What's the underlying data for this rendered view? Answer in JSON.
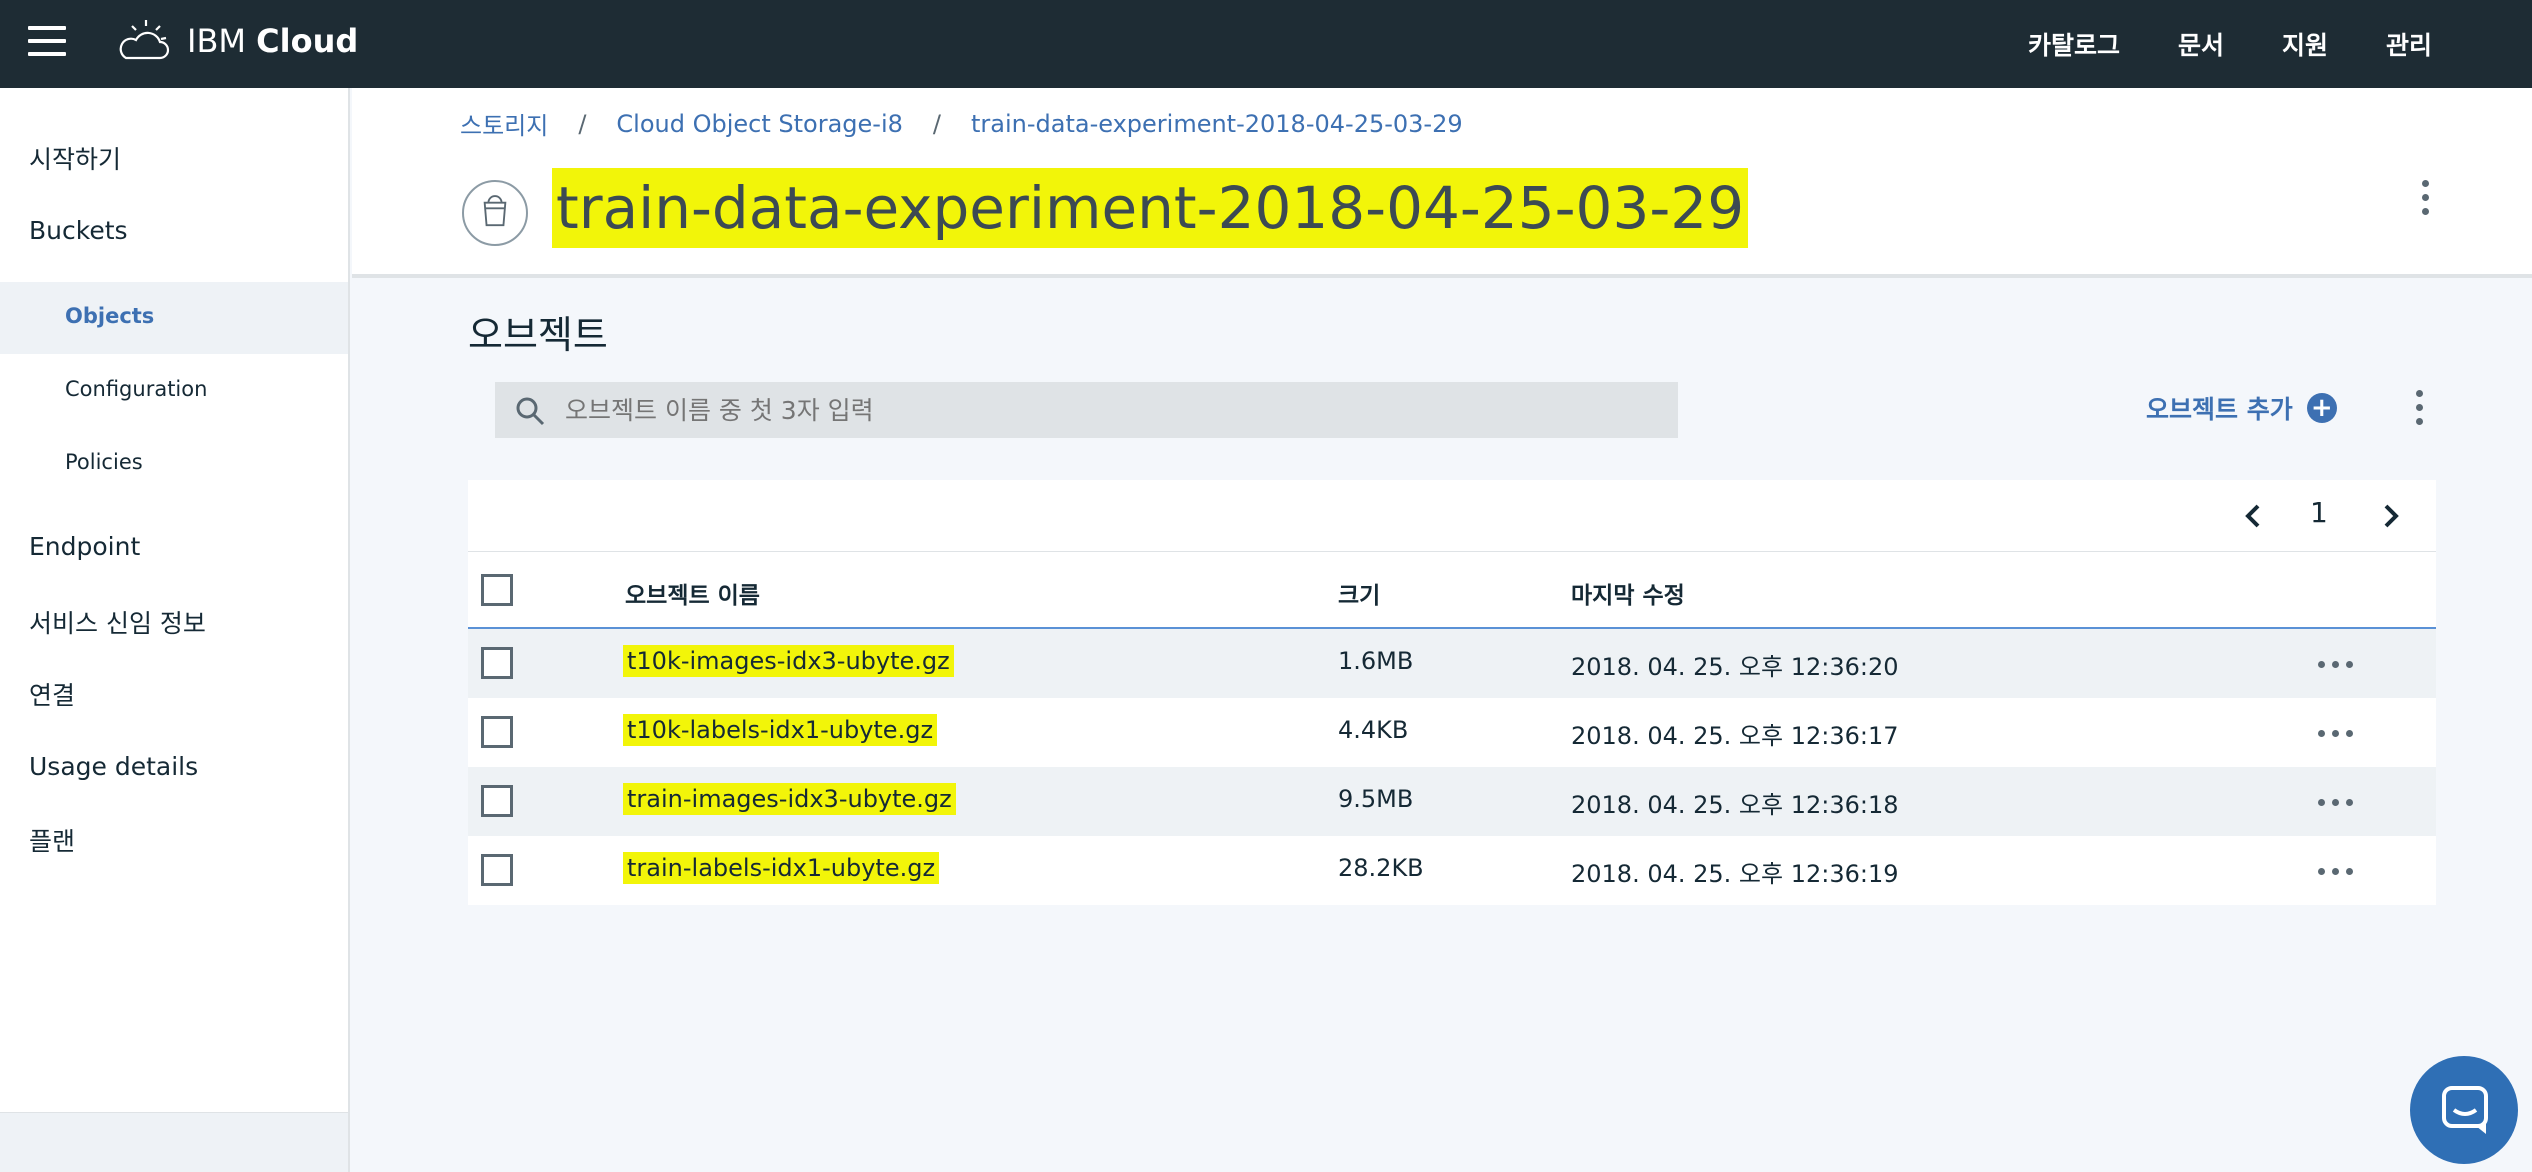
{
  "topbar": {
    "brand_prefix": "IBM",
    "brand_name": "Cloud",
    "nav": [
      "카탈로그",
      "문서",
      "지원",
      "관리"
    ]
  },
  "sidebar": {
    "items": [
      {
        "label": "시작하기"
      },
      {
        "label": "Buckets"
      },
      {
        "label": "Objects",
        "active": true
      },
      {
        "label": "Configuration"
      },
      {
        "label": "Policies"
      },
      {
        "label": "Endpoint"
      },
      {
        "label": "서비스 신임 정보"
      },
      {
        "label": "연결"
      },
      {
        "label": "Usage details"
      },
      {
        "label": "플랜"
      }
    ]
  },
  "breadcrumb": [
    "스토리지",
    "Cloud Object Storage-i8",
    "train-data-experiment-2018-04-25-03-29"
  ],
  "page_title": "train-data-experiment-2018-04-25-03-29",
  "section_title": "오브젝트",
  "search": {
    "placeholder": "오브젝트 이름 중 첫 3자 입력"
  },
  "add_object_label": "오브젝트 추가",
  "pager": {
    "page": "1"
  },
  "table": {
    "columns": [
      "오브젝트 이름",
      "크기",
      "마지막 수정"
    ],
    "rows": [
      {
        "name": "t10k-images-idx3-ubyte.gz",
        "size": "1.6MB",
        "modified": "2018. 04. 25. 오후 12:36:20"
      },
      {
        "name": "t10k-labels-idx1-ubyte.gz",
        "size": "4.4KB",
        "modified": "2018. 04. 25. 오후 12:36:17"
      },
      {
        "name": "train-images-idx3-ubyte.gz",
        "size": "9.5MB",
        "modified": "2018. 04. 25. 오후 12:36:18"
      },
      {
        "name": "train-labels-idx1-ubyte.gz",
        "size": "28.2KB",
        "modified": "2018. 04. 25. 오후 12:36:19"
      }
    ]
  },
  "colors": {
    "topbar": "#1e2c34",
    "accent": "#3d70b2",
    "highlight": "#f2f509",
    "chat": "#2f6fb5"
  },
  "icons": [
    "hamburger-menu-icon",
    "ibm-cloud-logo-icon",
    "bucket-icon",
    "search-icon",
    "plus-circle-icon",
    "chevron-left-icon",
    "chevron-right-icon",
    "overflow-menu-icon",
    "chat-icon"
  ]
}
